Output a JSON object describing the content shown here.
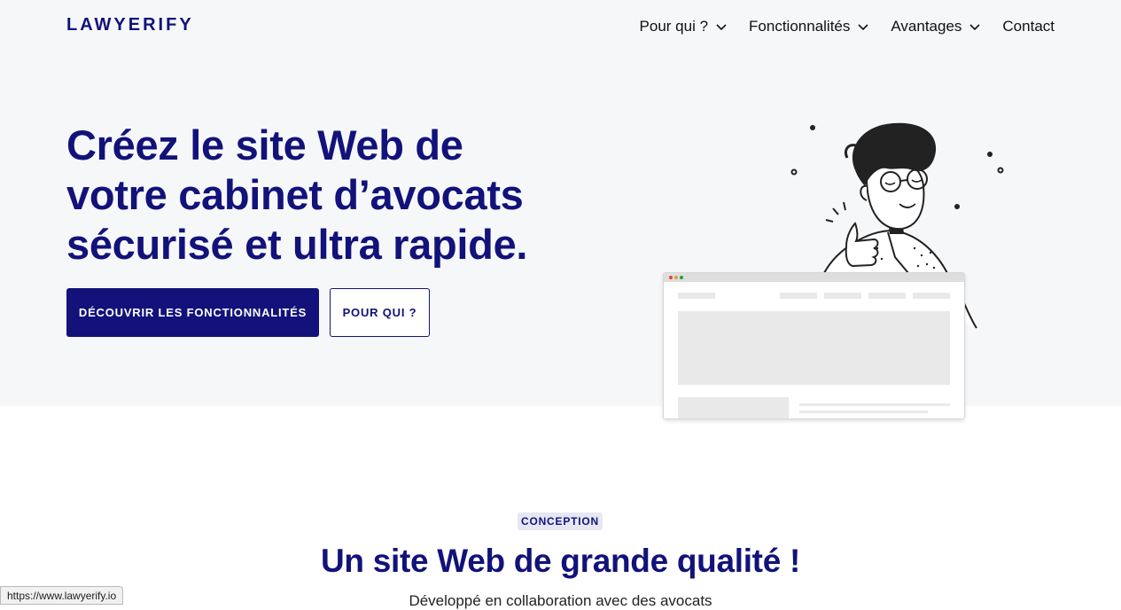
{
  "header": {
    "logo": "LAWYERIFY",
    "nav": [
      {
        "label": "Pour qui ?",
        "has_dropdown": true
      },
      {
        "label": "Fonctionnalités",
        "has_dropdown": true
      },
      {
        "label": "Avantages",
        "has_dropdown": true
      },
      {
        "label": "Contact",
        "has_dropdown": false
      }
    ]
  },
  "hero": {
    "title_lines": [
      "Créez le site Web de",
      "votre cabinet d’avocats",
      "sécurisé et ultra rapide."
    ],
    "primary_button": "DÉCOUVRIR LES FONCTIONNALITÉS",
    "secondary_button": "POUR QUI ?"
  },
  "section": {
    "tag": "CONCEPTION",
    "title": "Un site Web de grande qualité !",
    "subtitle": "Développé en collaboration avec des avocats"
  },
  "status_bar": {
    "url": "https://www.lawyerify.io"
  },
  "colors": {
    "brand": "#12127a",
    "hero_bg": "#f6f7f9",
    "tag_bg": "#e6e7f3"
  },
  "icons": {
    "dropdown": "chevron-down-icon",
    "illustration": "man-thumbs-up-illustration"
  }
}
